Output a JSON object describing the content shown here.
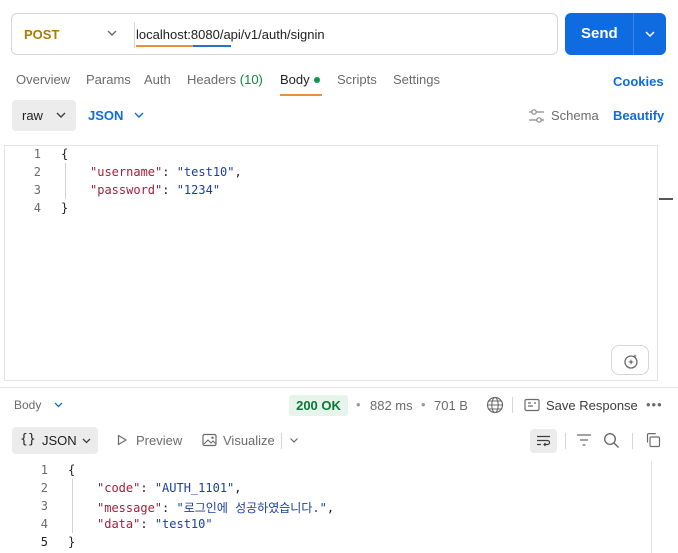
{
  "request": {
    "method": "POST",
    "url": "localhost:8080/api/v1/auth/signin",
    "send_label": "Send"
  },
  "tabs": {
    "overview": "Overview",
    "params": "Params",
    "auth": "Auth",
    "headers": "Headers",
    "headers_count": "(10)",
    "body": "Body",
    "scripts": "Scripts",
    "settings": "Settings",
    "cookies": "Cookies"
  },
  "body_toolbar": {
    "mode": "raw",
    "format": "JSON",
    "schema": "Schema",
    "beautify": "Beautify"
  },
  "request_body": {
    "line_numbers": [
      "1",
      "2",
      "3",
      "4"
    ],
    "open": "{",
    "close": "}",
    "fields": [
      {
        "key": "\"username\"",
        "value": "\"test10\"",
        "trail": ","
      },
      {
        "key": "\"password\"",
        "value": "\"1234\"",
        "trail": ""
      }
    ]
  },
  "response_bar": {
    "body_label": "Body",
    "status": "200 OK",
    "time": "882 ms",
    "size": "701 B",
    "separator": "•",
    "save_response": "Save Response",
    "more": "•••"
  },
  "response_toolbar": {
    "format_icon": "{}",
    "format": "JSON",
    "preview": "Preview",
    "visualize": "Visualize"
  },
  "response_body": {
    "line_numbers": [
      "1",
      "2",
      "3",
      "4",
      "5"
    ],
    "open": "{",
    "close": "}",
    "fields": [
      {
        "key": "\"code\"",
        "value": "\"AUTH_1101\"",
        "trail": ","
      },
      {
        "key": "\"message\"",
        "value": "\"로그인에 성공하였습니다.\"",
        "trail": ","
      },
      {
        "key": "\"data\"",
        "value": "\"test10\"",
        "trail": ""
      }
    ]
  },
  "icons": {
    "method_caret": "chevron-down-icon",
    "send_caret": "chevron-down-icon",
    "schema": "sliders-icon",
    "ai": "sparkle-icon",
    "globe": "globe-icon",
    "save_response": "save-response-icon",
    "wrap": "wrap-lines-icon",
    "filter": "filter-icon",
    "search": "search-icon",
    "copy": "copy-icon"
  },
  "colors": {
    "accent": "#0f6be0",
    "post": "#ad7a03",
    "status_ok": "#0a7a36",
    "tab_underline": "#e8903c",
    "json_key": "#a0213c",
    "json_string": "#1a3f9e"
  }
}
